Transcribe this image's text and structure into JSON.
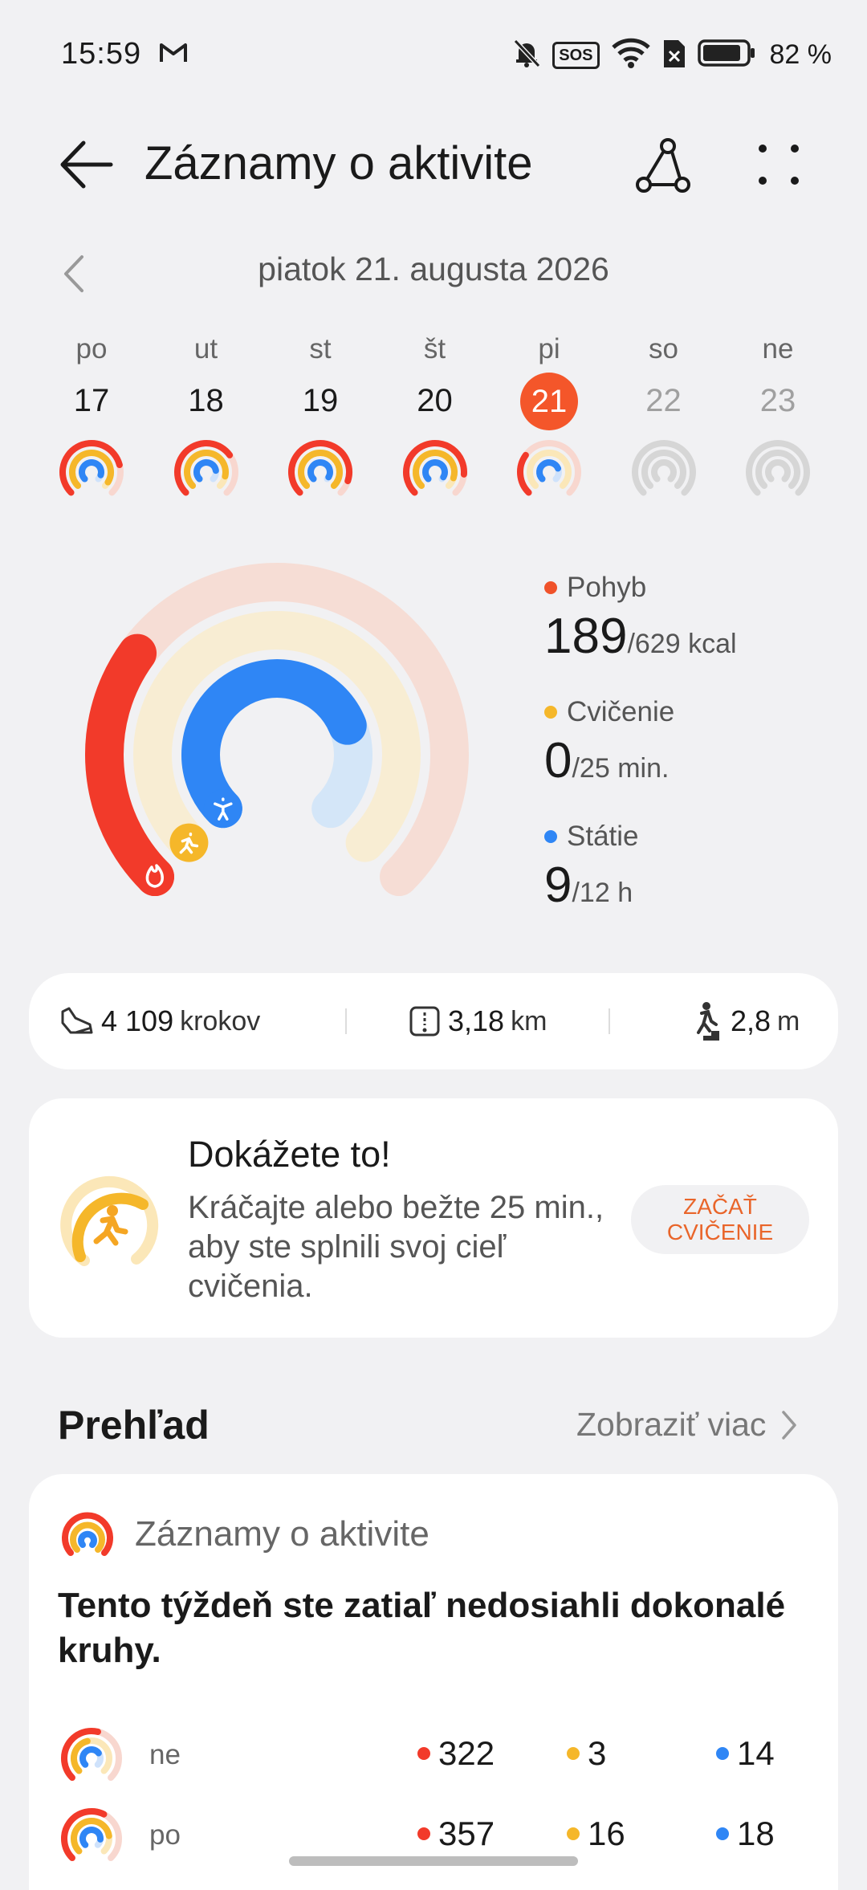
{
  "status": {
    "time": "15:59",
    "battery": "82 %",
    "sos": "SOS"
  },
  "header": {
    "title": "Záznamy o aktivite"
  },
  "date": {
    "label": "piatok 21. augusta 2026"
  },
  "week": [
    {
      "name": "po",
      "num": "17",
      "state": "past",
      "move": 0.78,
      "exercise": 0.95,
      "stand": 0.9
    },
    {
      "name": "ut",
      "num": "18",
      "state": "past",
      "move": 0.7,
      "exercise": 0.88,
      "stand": 0.8
    },
    {
      "name": "st",
      "num": "19",
      "state": "past",
      "move": 0.9,
      "exercise": 1.0,
      "stand": 0.95
    },
    {
      "name": "št",
      "num": "20",
      "state": "past",
      "move": 0.85,
      "exercise": 0.9,
      "stand": 0.95
    },
    {
      "name": "pi",
      "num": "21",
      "state": "selected",
      "move": 0.3,
      "exercise": 0.0,
      "stand": 0.75
    },
    {
      "name": "so",
      "num": "22",
      "state": "future",
      "move": 0,
      "exercise": 0,
      "stand": 0
    },
    {
      "name": "ne",
      "num": "23",
      "state": "future",
      "move": 0,
      "exercise": 0,
      "stand": 0
    }
  ],
  "rings": {
    "move": {
      "label": "Pohyb",
      "value": "189",
      "goal": "/629 kcal",
      "progress": 0.3,
      "color": "#f23a2a"
    },
    "exercise": {
      "label": "Cvičenie",
      "value": "0",
      "goal": "/25 min.",
      "progress": 0.0,
      "color": "#f5b72a"
    },
    "stand": {
      "label": "Státie",
      "value": "9",
      "goal": "/12 h",
      "progress": 0.75,
      "color": "#2f86f5"
    }
  },
  "stats": {
    "steps_value": "4 109",
    "steps_unit": "krokov",
    "distance_value": "3,18",
    "distance_unit": "km",
    "climb_value": "2,8",
    "climb_unit": "m"
  },
  "motivation": {
    "title": "Dokážete to!",
    "text": "Kráčajte alebo bežte 25 min., aby ste splnili svoj cieľ cvičenia.",
    "button": "ZAČAŤ CVIČENIE"
  },
  "overview": {
    "title": "Prehľad",
    "more": "Zobraziť viac",
    "card_title": "Záznamy o aktivite",
    "message": "Tento týždeň ste zatiaľ nedosiahli dokonalé kruhy.",
    "rows": [
      {
        "day": "ne",
        "move": "322",
        "exercise": "3",
        "stand": "14"
      },
      {
        "day": "po",
        "move": "357",
        "exercise": "16",
        "stand": "18"
      }
    ]
  },
  "colors": {
    "move": "#f23a2a",
    "exercise": "#f5b72a",
    "stand": "#2f86f5",
    "accent": "#f4562a"
  }
}
